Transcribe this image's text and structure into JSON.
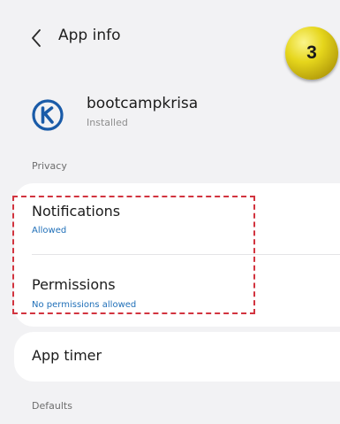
{
  "header": {
    "title": "App info",
    "step_number": "3"
  },
  "app": {
    "name": "bootcampkrisa",
    "status": "Installed",
    "icon": "app-logo-k"
  },
  "sections": {
    "privacy_label": "Privacy",
    "defaults_label": "Defaults"
  },
  "privacy_items": [
    {
      "title": "Notifications",
      "subtitle": "Allowed"
    },
    {
      "title": "Permissions",
      "subtitle": "No permissions allowed"
    }
  ],
  "app_timer": {
    "title": "App timer"
  },
  "colors": {
    "accent": "#1f6fb8",
    "highlight": "#d2343f",
    "badge": "#e6d61c",
    "app_icon": "#1a5ba8"
  }
}
